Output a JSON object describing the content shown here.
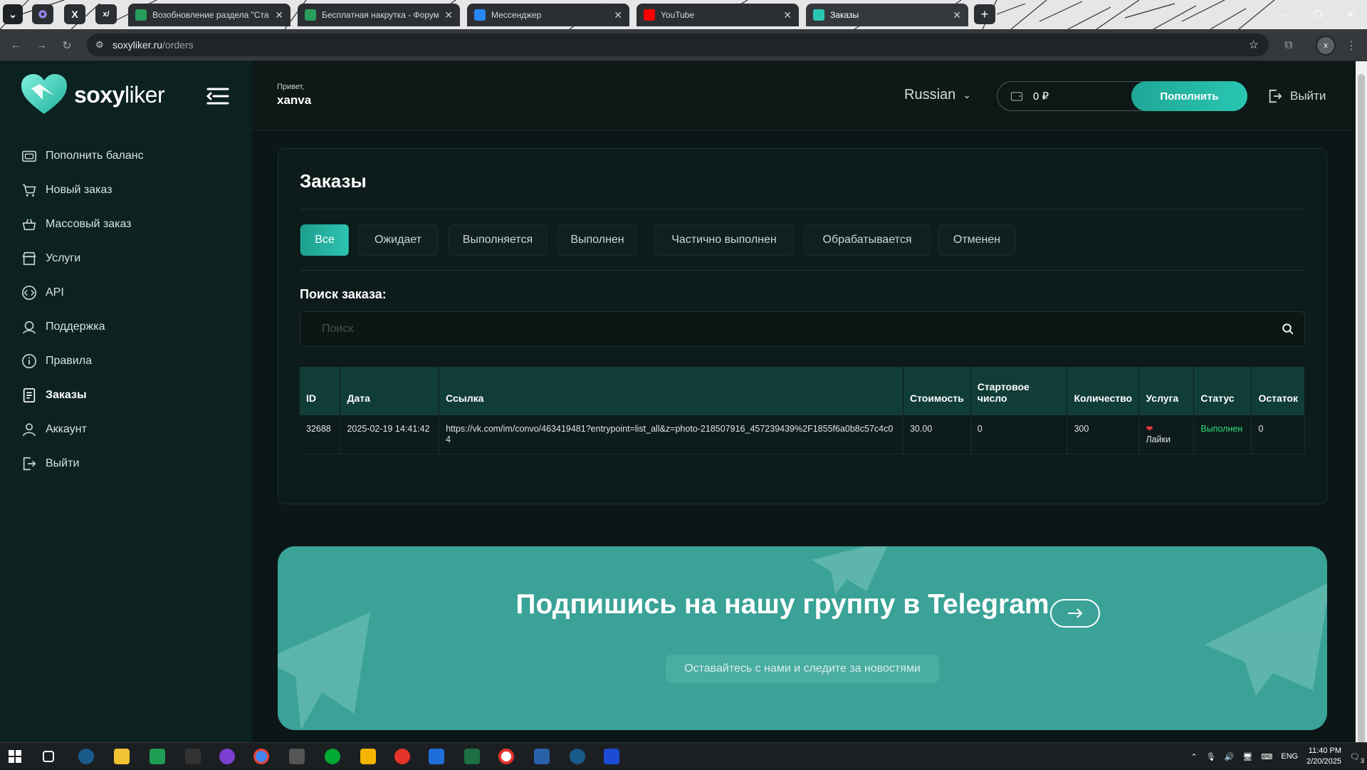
{
  "browser": {
    "tabs": [
      {
        "title": "Возобновление раздела \"Ста",
        "favicon_color": "#2a9d5c"
      },
      {
        "title": "Бесплатная накрутка - Форум",
        "favicon_color": "#2a9d5c"
      },
      {
        "title": "Мессенджер",
        "favicon_color": "#2787f5"
      },
      {
        "title": "YouTube",
        "favicon_color": "#ff0000"
      },
      {
        "title": "Заказы",
        "favicon_color": "#29c6b2"
      }
    ],
    "pinned": [
      "X",
      "x/"
    ],
    "url_host": "soxyliker.ru",
    "url_path": "/orders"
  },
  "logo": {
    "word_bold": "soxy",
    "word_light": "liker"
  },
  "sidebar": {
    "items": [
      {
        "label": "Пополнить баланс",
        "icon": "wallet-icon"
      },
      {
        "label": "Новый заказ",
        "icon": "cart-icon"
      },
      {
        "label": "Массовый заказ",
        "icon": "bulk-cart-icon"
      },
      {
        "label": "Услуги",
        "icon": "store-icon"
      },
      {
        "label": "API",
        "icon": "code-icon"
      },
      {
        "label": "Поддержка",
        "icon": "support-icon"
      },
      {
        "label": "Правила",
        "icon": "info-icon"
      },
      {
        "label": "Заказы",
        "icon": "orders-icon"
      },
      {
        "label": "Аккаунт",
        "icon": "user-icon"
      },
      {
        "label": "Выйти",
        "icon": "logout-icon"
      }
    ],
    "active_index": 7
  },
  "header": {
    "greeting": "Привет,",
    "username": "xanva",
    "language": "Russian",
    "balance": "0 ₽",
    "topup_label": "Пополнить",
    "logout_label": "Выйти"
  },
  "orders": {
    "title": "Заказы",
    "filters": [
      "Все",
      "Ожидает",
      "Выполняется",
      "Выполнен",
      "Частично выполнен",
      "Обрабатывается",
      "Отменен"
    ],
    "active_filter": 0,
    "search_label": "Поиск заказа:",
    "search_placeholder": "Поиск",
    "columns": [
      "ID",
      "Дата",
      "Ссылка",
      "Стоимость",
      "Стартовое число",
      "Количество",
      "Услуга",
      "Статус",
      "Остаток"
    ],
    "rows": [
      {
        "id": "32688",
        "date": "2025-02-19 14:41:42",
        "link": "https://vk.com/im/convo/463419481?entrypoint=list_all&z=photo-218507916_457239439%2F1855f6a0b8c57c4c04",
        "cost": "30.00",
        "start": "0",
        "quantity": "300",
        "service": "Лайки",
        "status": "Выполнен",
        "remains": "0"
      }
    ]
  },
  "banner": {
    "title": "Подпишись на нашу группу в Telegram",
    "subtitle": "Оставайтесь с нами и следите за новостями"
  },
  "taskbar": {
    "lang": "ENG",
    "time": "11:40 PM",
    "date": "2/20/2025",
    "notifications": "3"
  },
  "colors": {
    "accent": "#29c6b2",
    "status_done": "#2ee07a",
    "banner": "#3aa297"
  }
}
